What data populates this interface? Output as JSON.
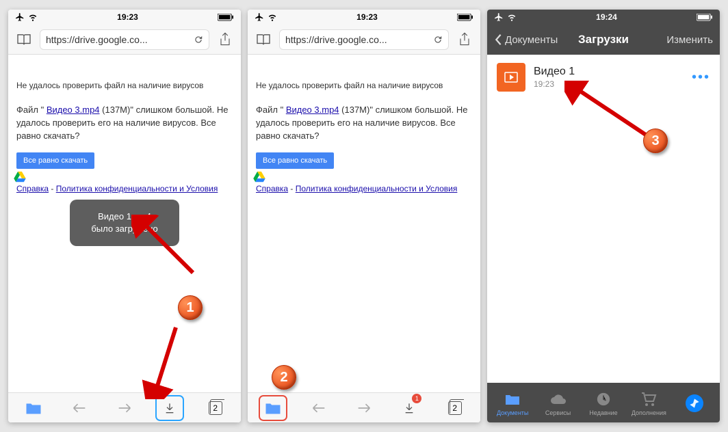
{
  "phone1": {
    "status": {
      "time": "19:23"
    },
    "url": "https://drive.google.co...",
    "warn_title": "Не удалось проверить файл на наличие вирусов",
    "warn_body_pre": "Файл \" ",
    "warn_body_link": "Видео 3.mp4",
    "warn_body_post": " (137M)\" слишком большой. Не удалось проверить его на наличие вирусов. Все равно скачать?",
    "download_btn": "Все равно скачать",
    "links_help": "Справка",
    "links_sep": " - ",
    "links_terms": "Политика конфиденциальности и Условия",
    "toast_line1": "Видео 1.mp4",
    "toast_line2": "было загружено",
    "tabs_count": "2",
    "step": "1"
  },
  "phone2": {
    "status": {
      "time": "19:23"
    },
    "url": "https://drive.google.co...",
    "warn_title": "Не удалось проверить файл на наличие вирусов",
    "warn_body_pre": "Файл \" ",
    "warn_body_link": "Видео 3.mp4",
    "warn_body_post": " (137M)\" слишком большой. Не удалось проверить его на наличие вирусов. Все равно скачать?",
    "download_btn": "Все равно скачать",
    "links_help": "Справка",
    "links_sep": " - ",
    "links_terms": "Политика конфиденциальности и Условия",
    "tabs_count": "2",
    "badge_count": "1",
    "step": "2"
  },
  "phone3": {
    "status": {
      "time": "19:24"
    },
    "back_label": "Документы",
    "title": "Загрузки",
    "edit": "Изменить",
    "file_name": "Видео 1",
    "file_time": "19:23",
    "more": "•••",
    "tabs": {
      "docs": "Документы",
      "services": "Сервисы",
      "recent": "Недавние",
      "addons": "Дополнения"
    },
    "step": "3"
  }
}
